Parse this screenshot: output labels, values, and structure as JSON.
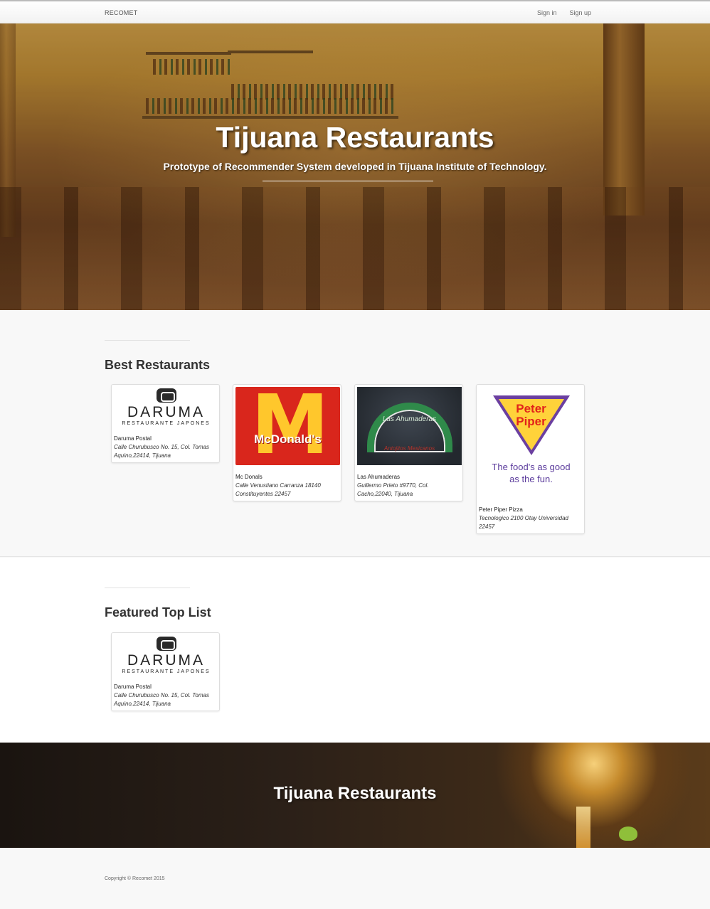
{
  "navbar": {
    "brand": "RECOMET",
    "links": [
      "Sign in",
      "Sign up"
    ]
  },
  "hero": {
    "title": "Tijuana Restaurants",
    "subtitle": "Prototype of Recommender System developed in Tijuana Institute of Technology."
  },
  "best": {
    "title": "Best Restaurants",
    "cards": [
      {
        "name": "Daruma Postal",
        "address": "Calle Churubusco No. 15, Col. Tomas Aquino,22414, Tijuana",
        "logo": "daruma-logo"
      },
      {
        "name": "Mc Donals",
        "address": "Calle Venustiano Carranza 18140 Constituyentes 22457",
        "logo": "mcdonalds-logo"
      },
      {
        "name": "Las Ahumaderas",
        "address": "Guillermo Prieto #9770, Col. Cacho,22040, Tijuana",
        "logo": "las-ahumaderas-logo"
      },
      {
        "name": "Peter Piper Pizza",
        "address": "Tecnologico 2100 Otay Universidad 22457",
        "logo": "peter-piper-logo"
      }
    ]
  },
  "featured": {
    "title": "Featured Top List",
    "cards": [
      {
        "name": "Daruma Postal",
        "address": "Calle Churubusco No. 15, Col. Tomas Aquino,22414, Tijuana",
        "logo": "daruma-logo"
      }
    ]
  },
  "logos": {
    "daruma_word": "DARUMA",
    "daruma_sub": "RESTAURANTE JAPONES",
    "mcd_arch": "M",
    "mcd_word": "McDonald's",
    "ahu_text": "Las Ahumaderas",
    "ahu_red": "Antojitos Mexicanos",
    "pp_name_1": "Peter",
    "pp_name_2": "Piper",
    "pp_tag_1": "The food's as good",
    "pp_tag_2": "as the fun."
  },
  "banner": {
    "title": "Tijuana Restaurants"
  },
  "footer": {
    "copyright": "Copyright © Recomet 2015"
  },
  "colors": {
    "mcd_red": "#d9261c",
    "mcd_yellow": "#ffc72c",
    "pp_purple": "#6b3fa0",
    "pp_yellow": "#ffd23a",
    "ahu_green": "#2f8a4a"
  }
}
